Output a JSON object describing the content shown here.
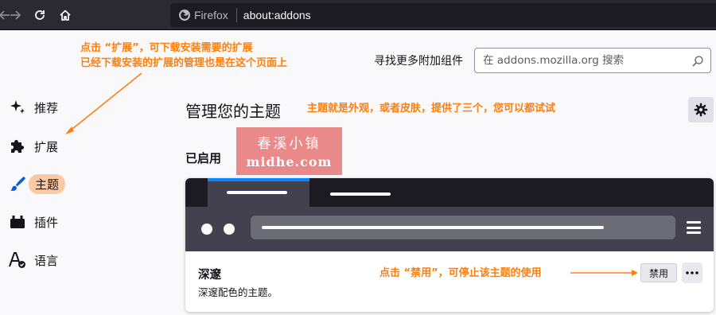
{
  "browser": {
    "brand": "Firefox",
    "url": "about:addons"
  },
  "sidebar": {
    "items": [
      {
        "label": "推荐",
        "icon": "sparkle-icon"
      },
      {
        "label": "扩展",
        "icon": "puzzle-icon"
      },
      {
        "label": "主题",
        "icon": "brush-icon",
        "selected": true
      },
      {
        "label": "插件",
        "icon": "plugin-icon"
      },
      {
        "label": "语言",
        "icon": "language-icon"
      }
    ]
  },
  "header": {
    "search_label": "寻找更多附加组件",
    "search_placeholder": "在 addons.mozilla.org 搜索"
  },
  "main": {
    "title": "管理您的主题",
    "enabled_section": "已启用",
    "theme": {
      "name": "深邃",
      "description": "深邃配色的主题。",
      "disable_label": "禁用",
      "more_label": "•••"
    }
  },
  "annotations": {
    "note_extensions_line1": "点击 “扩展”，可下载安装需要的扩展",
    "note_extensions_line2": "已经下载安装的扩展的管理也是在这个页面上",
    "note_themes": "主题就是外观，或者皮肤，提供了三个，您可以都试试",
    "note_disable": "点击 “禁用”，可停止该主题的使用",
    "color": "#ff7f0e"
  },
  "watermark": {
    "line1": "春溪小镇",
    "line2": "midhe.com",
    "color": "#e9898a"
  }
}
